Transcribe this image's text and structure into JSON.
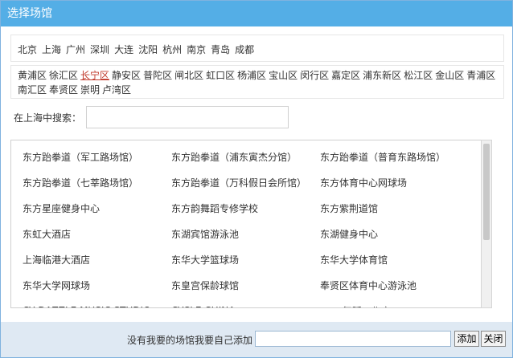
{
  "dialog": {
    "title": "选择场馆"
  },
  "cities": [
    "北京",
    "上海",
    "广州",
    "深圳",
    "大连",
    "沈阳",
    "杭州",
    "南京",
    "青岛",
    "成都"
  ],
  "districts": {
    "active": "长宁区",
    "items": [
      "黄浦区",
      "徐汇区",
      "长宁区",
      "静安区",
      "普陀区",
      "闸北区",
      "虹口区",
      "杨浦区",
      "宝山区",
      "闵行区",
      "嘉定区",
      "浦东新区",
      "松江区",
      "金山区",
      "青浦区",
      "南汇区",
      "奉贤区",
      "崇明",
      "卢湾区"
    ]
  },
  "search": {
    "label": "在上海中搜索：",
    "value": ""
  },
  "venues": [
    "东方跆拳道（军工路场馆）",
    "东方跆拳道（浦东寅杰分馆）",
    "东方跆拳道（普育东路场馆）",
    "东方跆拳道（七莘路场馆）",
    "东方跆拳道（万科假日会所馆）",
    "东方体育中心网球场",
    "东方星座健身中心",
    "东方韵舞蹈专修学校",
    "东方紫荆道馆",
    "东虹大酒店",
    "东湖宾馆游泳池",
    "东湖健身中心",
    "上海临港大酒店",
    "东华大学篮球场",
    "东华大学体育馆",
    "东华大学网球场",
    "东皇宫保龄球馆",
    "奉贤区体育中心游泳池",
    "CY DAZZLE MUSIC STUDIO",
    "CYCLE CHINA",
    "D&D舞蹈工作室"
  ],
  "footer": {
    "label": "没有我要的场馆我要自己添加",
    "add_label": "添加",
    "close_label": "关闭",
    "value": ""
  }
}
